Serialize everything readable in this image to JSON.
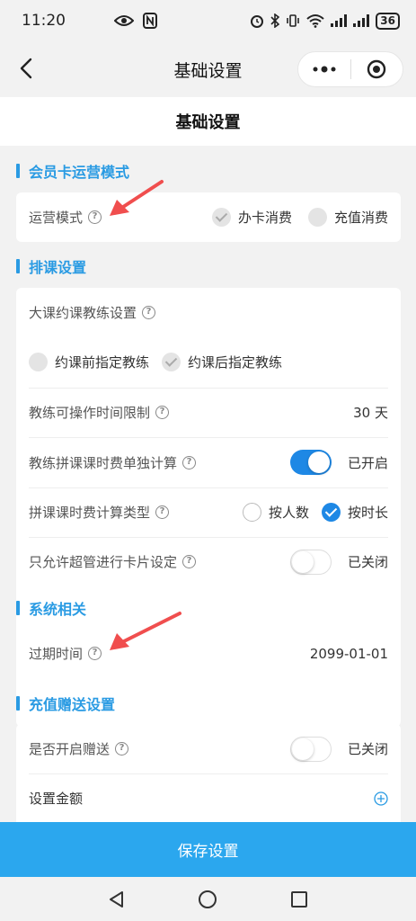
{
  "status_bar": {
    "time": "11:20",
    "battery": "36"
  },
  "nav": {
    "title": "基础设置"
  },
  "page": {
    "header": "基础设置"
  },
  "sections": {
    "membership": {
      "title": "会员卡运营模式",
      "mode_label": "运营模式",
      "option_card": "办卡消费",
      "option_recharge": "充值消费"
    },
    "schedule": {
      "title": "排课设置",
      "big_class_label": "大课约课教练设置",
      "option_before": "约课前指定教练",
      "option_after": "约课后指定教练",
      "time_limit_label": "教练可操作时间限制",
      "time_limit_value": "30 天",
      "fee_separate_label": "教练拼课课时费单独计算",
      "fee_separate_status": "已开启",
      "fee_type_label": "拼课课时费计算类型",
      "fee_by_people": "按人数",
      "fee_by_duration": "按时长",
      "super_admin_label": "只允许超管进行卡片设定",
      "super_admin_status": "已关闭"
    },
    "system": {
      "title": "系统相关",
      "expire_label": "过期时间",
      "expire_value": "2099-01-01"
    },
    "recharge": {
      "title": "充值赠送设置",
      "gift_label": "是否开启赠送",
      "gift_status": "已关闭",
      "amount_label": "设置金额"
    }
  },
  "footer": {
    "save_label": "保存设置"
  },
  "colors": {
    "accent": "#1e88e5",
    "section_title": "#2a9be3",
    "save_button": "#2ba7ee",
    "arrow": "#f04e4e"
  }
}
